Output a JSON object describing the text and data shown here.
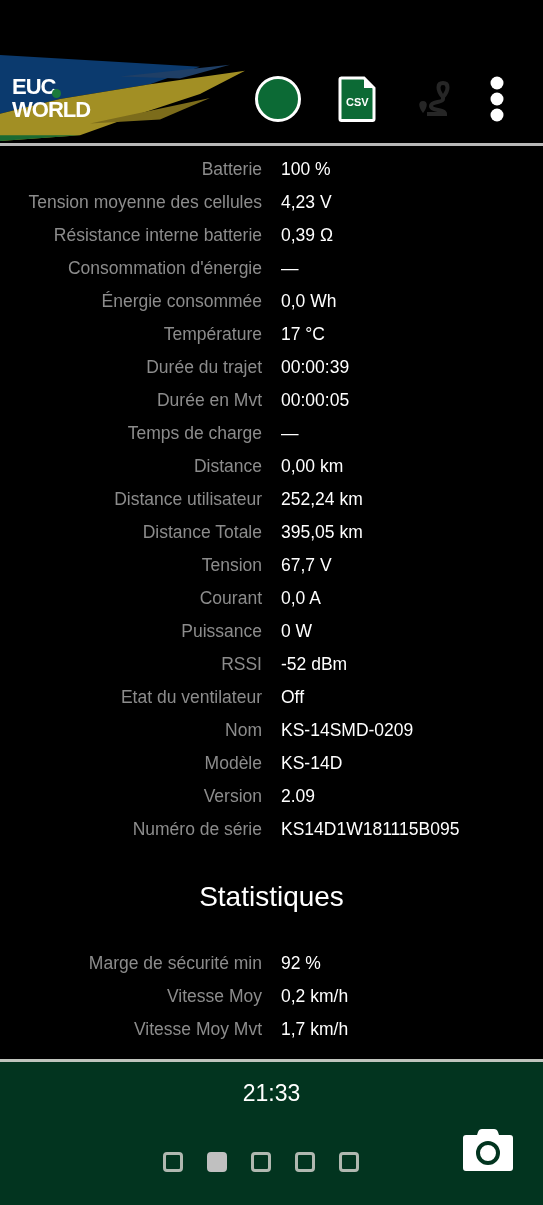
{
  "header": {
    "logo_lines": [
      "EUC",
      "WORLD"
    ],
    "actions": [
      {
        "kind": "record",
        "disabled": false
      },
      {
        "kind": "csv",
        "label": "CSV",
        "disabled": false
      },
      {
        "kind": "route",
        "disabled": true
      },
      {
        "kind": "menu",
        "disabled": false
      }
    ]
  },
  "rows": [
    {
      "label": "Batterie",
      "value": "100 %"
    },
    {
      "label": "Tension moyenne des cellules",
      "value": "4,23 V"
    },
    {
      "label": "Résistance interne batterie",
      "value": "0,39 Ω"
    },
    {
      "label": "Consommation d'énergie",
      "value": "—"
    },
    {
      "label": "Énergie consommée",
      "value": "0,0 Wh"
    },
    {
      "label": "Température",
      "value": "17 °C"
    },
    {
      "label": "Durée du trajet",
      "value": "00:00:39"
    },
    {
      "label": "Durée en Mvt",
      "value": "00:00:05"
    },
    {
      "label": "Temps de charge",
      "value": "—"
    },
    {
      "label": "Distance",
      "value": "0,00 km"
    },
    {
      "label": "Distance utilisateur",
      "value": "252,24 km"
    },
    {
      "label": "Distance Totale",
      "value": "395,05 km"
    },
    {
      "label": "Tension",
      "value": "67,7 V"
    },
    {
      "label": "Courant",
      "value": "0,0 A"
    },
    {
      "label": "Puissance",
      "value": "0 W"
    },
    {
      "label": "RSSI",
      "value": "-52 dBm"
    },
    {
      "label": "Etat du ventilateur",
      "value": "Off"
    },
    {
      "label": "Nom",
      "value": "KS-14SMD-0209"
    },
    {
      "label": "Modèle",
      "value": "KS-14D"
    },
    {
      "label": "Version",
      "value": "2.09"
    },
    {
      "label": "Numéro de série",
      "value": "KS14D1W181115B095"
    }
  ],
  "stats": {
    "title": "Statistiques",
    "rows": [
      {
        "label": "Marge de sécurité min",
        "value": "92 %"
      },
      {
        "label": "Vitesse Moy",
        "value": "0,2 km/h"
      },
      {
        "label": "Vitesse Moy Mvt",
        "value": "1,7 km/h"
      }
    ]
  },
  "footer": {
    "time": "21:33",
    "pages": [
      {
        "selected": false
      },
      {
        "selected": true
      },
      {
        "selected": false
      },
      {
        "selected": false
      },
      {
        "selected": false
      }
    ]
  }
}
